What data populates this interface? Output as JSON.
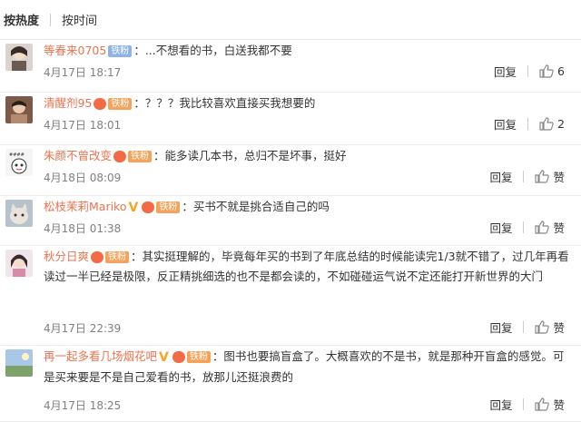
{
  "sort": {
    "hot": "按热度",
    "time": "按时间"
  },
  "reply_label": "回复",
  "comments": [
    {
      "user": "等春来0705",
      "badge": "铁粉",
      "badge_style": "blue",
      "verified": false,
      "text": "：...不想看的书，白送我都不要",
      "date": "4月17日 18:17",
      "likes": "6",
      "avatar_icon": "person-avatar-icon"
    },
    {
      "user": "清醒剂95",
      "badge": "铁粉",
      "badge_style": "orange",
      "verified": false,
      "text": "：？？？我比较喜欢直接买我想要的",
      "date": "4月17日 18:01",
      "likes": "2",
      "avatar_icon": "person-avatar-icon"
    },
    {
      "user": "朱颜不曾改变",
      "badge": "铁粉",
      "badge_style": "orange",
      "verified": false,
      "text": "：能多读几本书，总归不是坏事，挺好",
      "date": "4月18日 08:09",
      "likes": "赞",
      "avatar_icon": "cartoon-avatar-icon"
    },
    {
      "user": "松枝茉莉Mariko",
      "badge": "铁粉",
      "badge_style": "orange",
      "verified": true,
      "text": "：买书不就是挑合适自己的吗",
      "date": "4月18日 01:38",
      "likes": "赞",
      "avatar_icon": "cat-avatar-icon"
    },
    {
      "user": "秋分日爽",
      "badge": "铁粉",
      "badge_style": "orange",
      "verified": false,
      "text": "：其实挺理解的，毕竟每年买的书到了年底总结的时候能读完1/3就不错了，过几年再看读过一半已经是极限，反正精挑细选的也不是都会读的，不如碰碰运气说不定还能打开新世界的大门",
      "date": "4月17日 22:39",
      "likes": "赞",
      "avatar_icon": "girl-avatar-icon"
    },
    {
      "user": "再一起多看几场烟花吧",
      "badge": "铁粉",
      "badge_style": "orange",
      "verified": true,
      "text": "：图书也要搞盲盒了。大概喜欢的不是书，就是那种开盲盒的感觉。可是买来要是不是自己爱看的书，放那儿还挺浪费的",
      "date": "4月17日 18:25",
      "likes": "赞",
      "avatar_icon": "landscape-avatar-icon"
    }
  ]
}
